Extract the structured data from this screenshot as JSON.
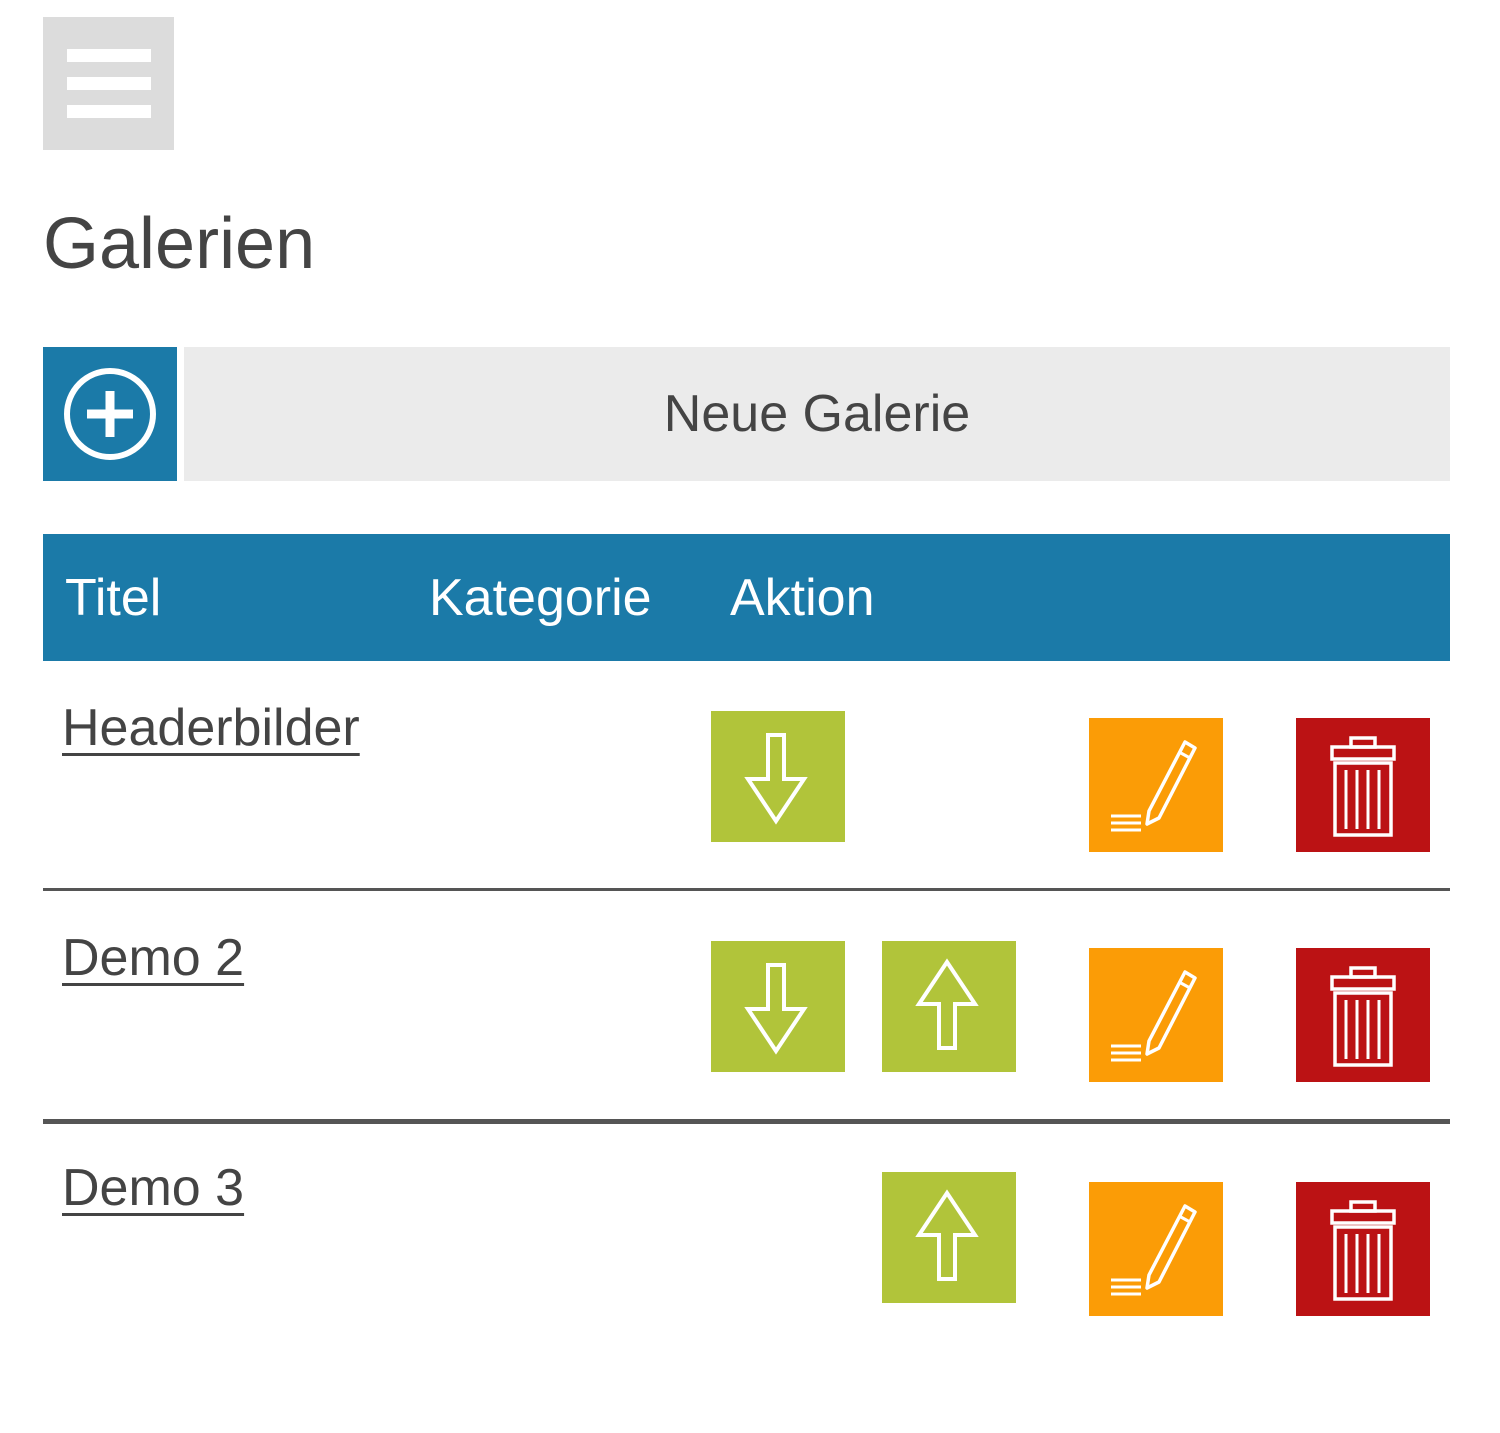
{
  "header": {
    "menu_icon": "hamburger-menu-icon"
  },
  "page": {
    "title": "Galerien"
  },
  "new_gallery": {
    "icon": "plus-circle-icon",
    "label": "Neue Galerie"
  },
  "table": {
    "columns": [
      "Titel",
      "Kategorie",
      "Aktion"
    ],
    "rows": [
      {
        "title": "Headerbilder",
        "category": "",
        "actions": [
          "move-down",
          "edit",
          "delete"
        ]
      },
      {
        "title": "Demo 2",
        "category": "",
        "actions": [
          "move-down",
          "move-up",
          "edit",
          "delete"
        ]
      },
      {
        "title": "Demo 3",
        "category": "",
        "actions": [
          "move-up",
          "edit",
          "delete"
        ]
      }
    ]
  },
  "colors": {
    "primary_blue": "#1b7aa8",
    "move_green": "#b1c43a",
    "edit_orange": "#fb9c06",
    "delete_red": "#bb1214",
    "light_gray": "#ebebeb",
    "menu_gray": "#dcdcdc",
    "text": "#444444"
  },
  "icons": {
    "move_down": "arrow-down-icon",
    "move_up": "arrow-up-icon",
    "edit": "pencil-icon",
    "delete": "trash-icon"
  }
}
